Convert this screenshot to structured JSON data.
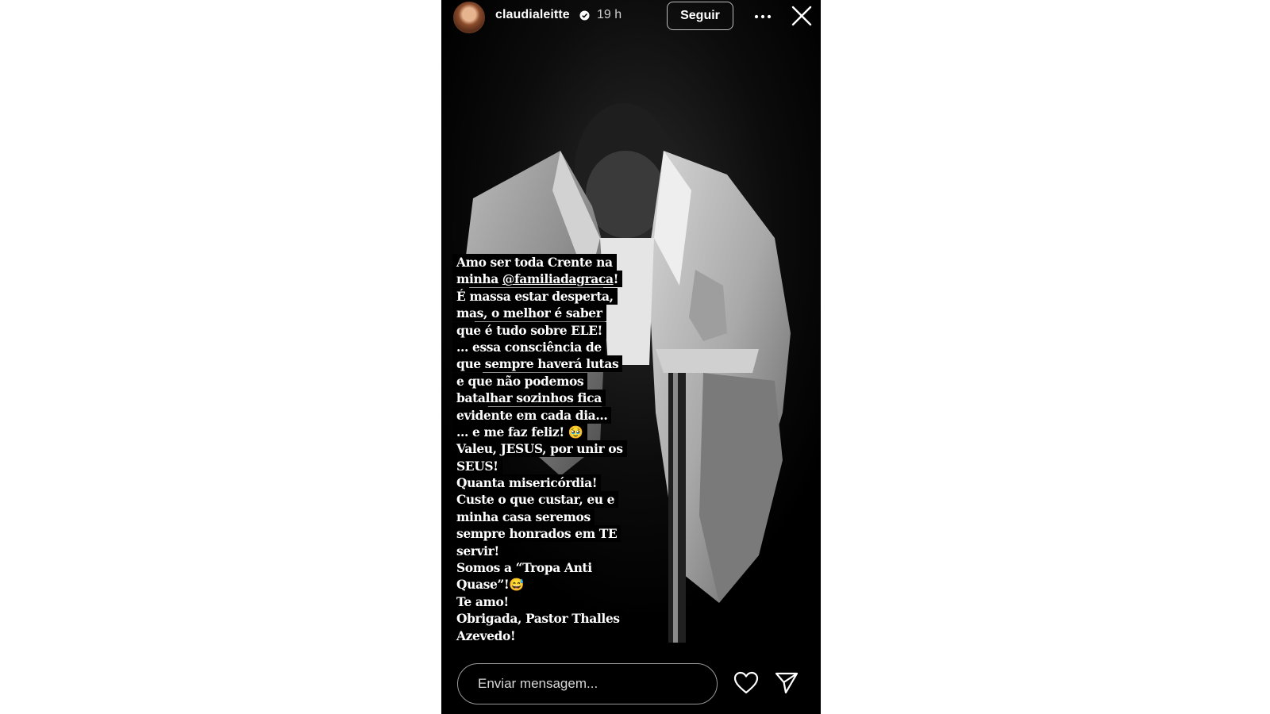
{
  "header": {
    "username": "claudialeitte",
    "time": "19 h",
    "follow_label": "Seguir"
  },
  "caption_lines": [
    "Amo ser toda Crente na",
    "minha @familiadagraca!",
    "É massa estar desperta,",
    "mas, o melhor é saber",
    "que é tudo sobre ELE!",
    "... essa consciência de",
    "que sempre haverá lutas",
    "e que não podemos",
    "batalhar sozinhos fica",
    "evidente em cada dia...",
    "... e me faz feliz! 🥹",
    "Valeu, JESUS, por unir os",
    "SEUS!",
    "Quanta misericórdia!",
    "Custe o que custar,  eu e",
    "minha casa seremos",
    "sempre  honrados em TE",
    "servir!",
    "Somos a “Tropa Anti",
    "Quase”!😅",
    "Te amo!",
    "Obrigada, Pastor Thalles",
    "Azevedo!"
  ],
  "caption": {
    "line1": "Amo ser toda Crente na",
    "line2_prefix": "minha ",
    "mention": "@familiadagraca",
    "line2_suffix": "!"
  },
  "footer": {
    "message_placeholder": "Enviar mensagem..."
  },
  "icons": {
    "verified": "verified-badge-icon",
    "more": "more-options-icon",
    "close": "close-icon",
    "like": "heart-icon",
    "share": "send-icon"
  },
  "colors": {
    "background": "#000000",
    "text": "#ffffff",
    "page": "#ffffff"
  }
}
